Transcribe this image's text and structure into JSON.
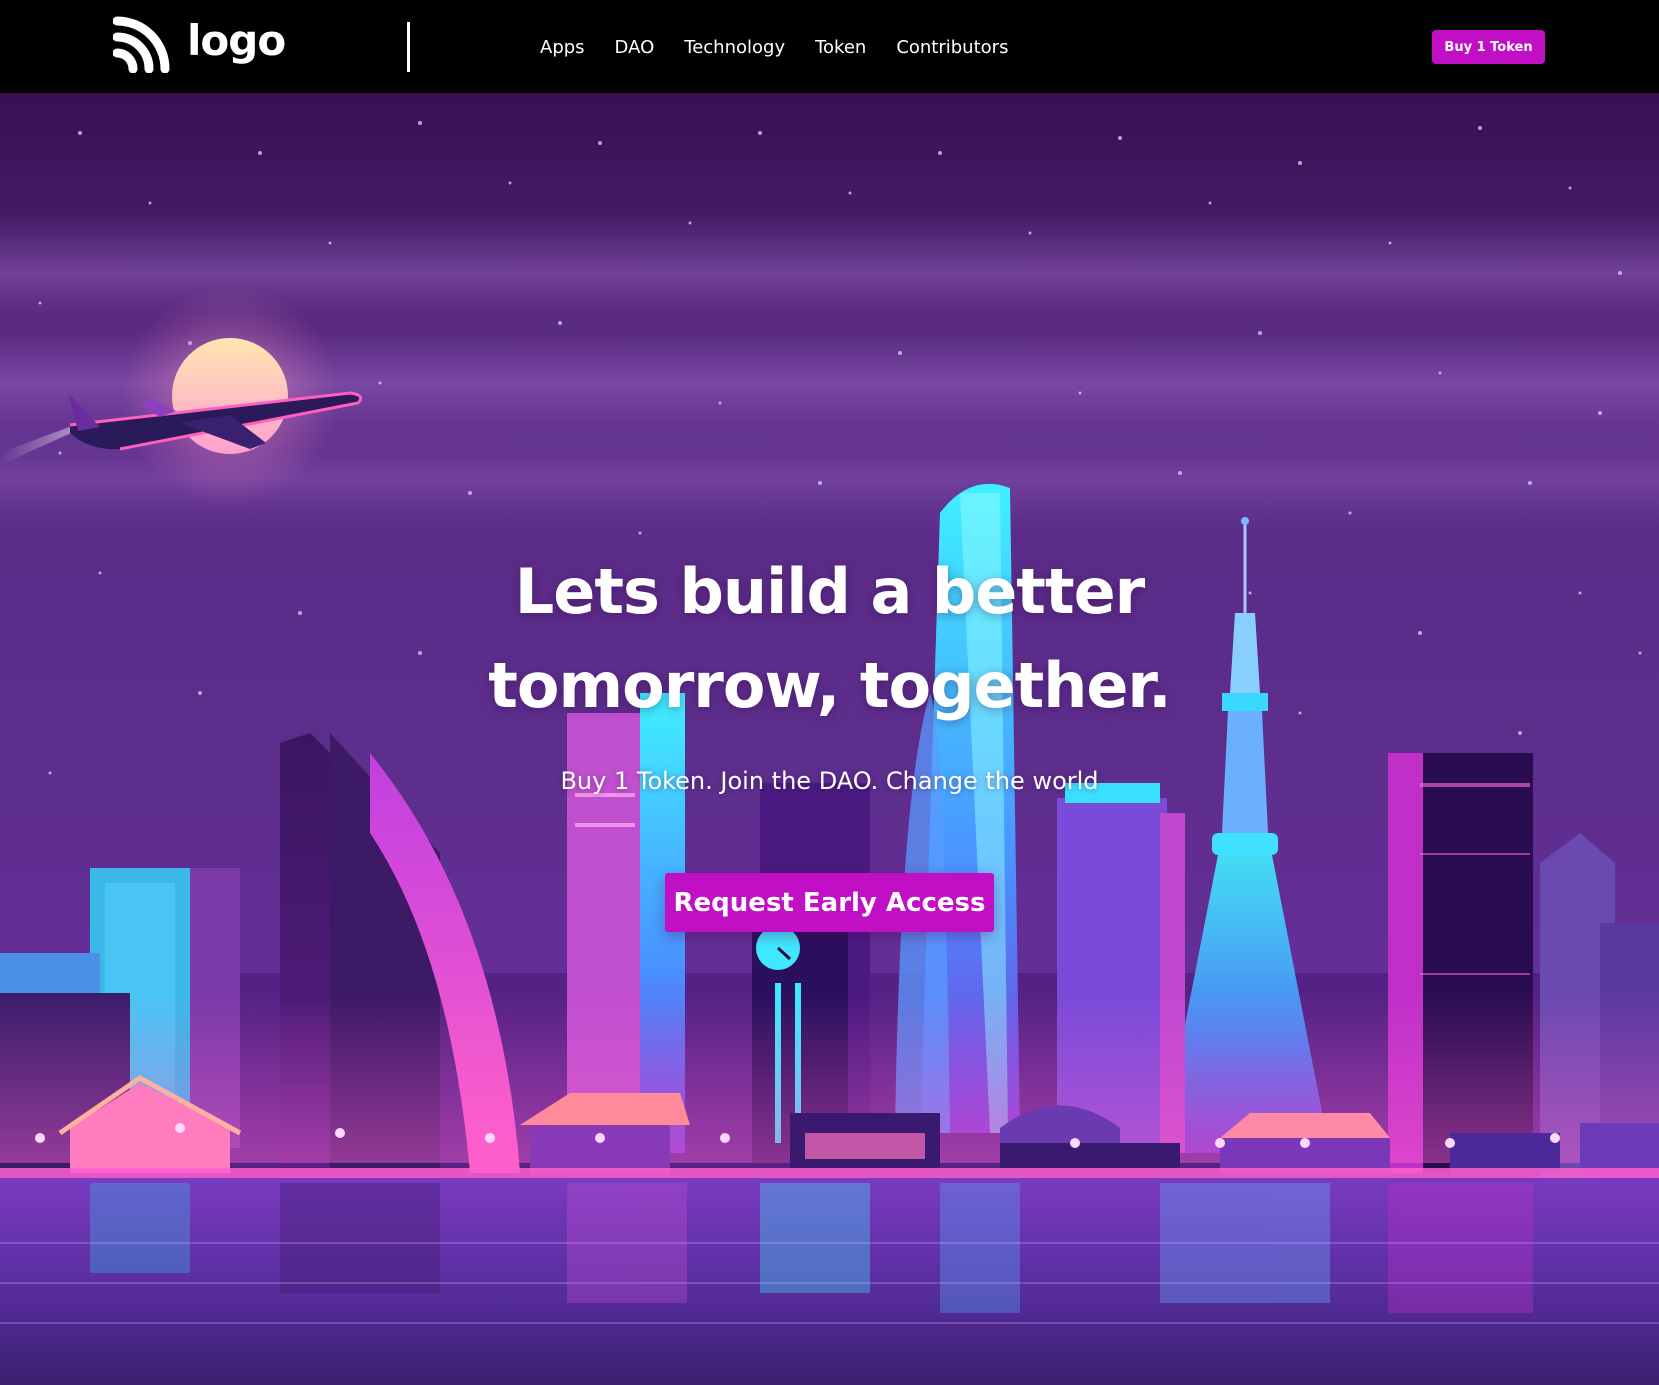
{
  "header": {
    "logo_text": "logo",
    "nav": [
      {
        "label": "Apps"
      },
      {
        "label": "DAO"
      },
      {
        "label": "Technology"
      },
      {
        "label": "Token"
      },
      {
        "label": "Contributors"
      }
    ],
    "buy_button_label": "Buy 1 Token"
  },
  "hero": {
    "title_line1": "Lets build a better",
    "title_line2": "tomorrow, together.",
    "subtitle": "Buy 1 Token. Join the DAO. Change the world",
    "cta_label": "Request Early Access"
  },
  "colors": {
    "accent": "#c00fc5",
    "header_bg": "#000000",
    "sky_top": "#3a1050",
    "sky_mid": "#6a3a9a",
    "neon_cyan": "#39d8ff",
    "neon_pink": "#ff4fd8"
  },
  "icons": {
    "logo_mark": "signal-arcs-icon",
    "moon": "moon-illustration",
    "airplane": "airplane-illustration"
  }
}
